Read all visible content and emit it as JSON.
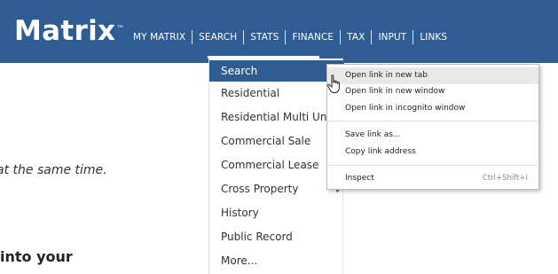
{
  "header": {
    "logo": "Matrix",
    "logo_tm": "™",
    "nav": [
      "MY MATRIX",
      "SEARCH",
      "STATS",
      "FINANCE",
      "TAX",
      "INPUT",
      "LINKS"
    ]
  },
  "background": {
    "text1": "at the same time.",
    "text2": "into your"
  },
  "dropdown": {
    "items": [
      "Search",
      "Residential",
      "Residential Multi Unit",
      "Commercial Sale",
      "Commercial Lease",
      "Cross Property",
      "History",
      "Public Record",
      "More..."
    ]
  },
  "context_menu": {
    "items": [
      "Open link in new tab",
      "Open link in new window",
      "Open link in incognito window",
      "Save link as...",
      "Copy link address",
      "Inspect"
    ],
    "inspect_shortcut": "Ctrl+Shift+I"
  },
  "colors": {
    "brand_blue": "#2f5d93"
  }
}
